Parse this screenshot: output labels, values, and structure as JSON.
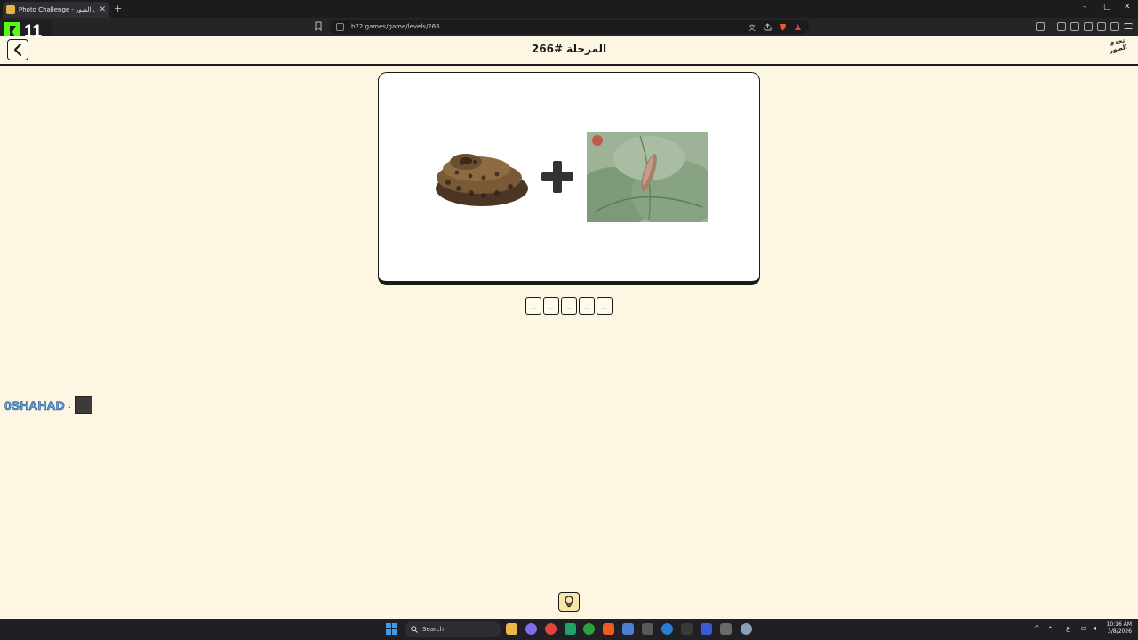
{
  "browser": {
    "tab_title": "Photo Challenge - تحدي الصور",
    "new_tab_label": "+",
    "url": "b22.games/game/levels/266",
    "window_controls": [
      "–",
      "▢",
      "✕"
    ]
  },
  "overlay": {
    "kick_count": "11"
  },
  "page": {
    "level_title": "المرحلة #266",
    "brand_logo_text": "تحدي الصور",
    "back_icon": "chevron-left-icon",
    "clue_images": [
      "snake-image",
      "worm-on-leaf-image"
    ],
    "operator_icon": "plus-icon",
    "answer_slots": [
      "_",
      "_",
      "_",
      "_",
      "_"
    ],
    "hint_icon": "lightbulb-icon"
  },
  "streamer": {
    "name": "0SHAHAD",
    "separator": ":"
  },
  "taskbar": {
    "search_label": "Search",
    "clock_time": "10:16 AM",
    "clock_date": "3/8/2026",
    "ime_label": "ع"
  }
}
